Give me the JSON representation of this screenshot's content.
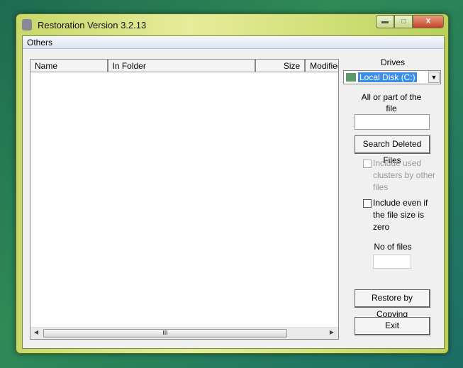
{
  "window": {
    "title": "Restoration Version 3.2.13",
    "controls": {
      "minimize": "minimize-icon",
      "maximize": "maximize-icon",
      "close": "close-icon"
    }
  },
  "menu": {
    "others": "Others"
  },
  "list": {
    "columns": [
      "Name",
      "In Folder",
      "Size",
      "Modified"
    ],
    "rows": [],
    "scroll_grip": "III"
  },
  "panel": {
    "drives_label": "Drives",
    "drive_selected": "Local Disk (C:)",
    "file_label": "All or part of the file",
    "file_value": "",
    "search_button": "Search Deleted Files",
    "include_used": {
      "label": "Include used clusters by other files",
      "checked": false,
      "enabled": false
    },
    "include_zero": {
      "label": "Include even if the file size is zero",
      "checked": false,
      "enabled": true
    },
    "nfiles_label": "No of files",
    "nfiles_value": "",
    "restore_button": "Restore by Copying",
    "exit_button": "Exit"
  }
}
